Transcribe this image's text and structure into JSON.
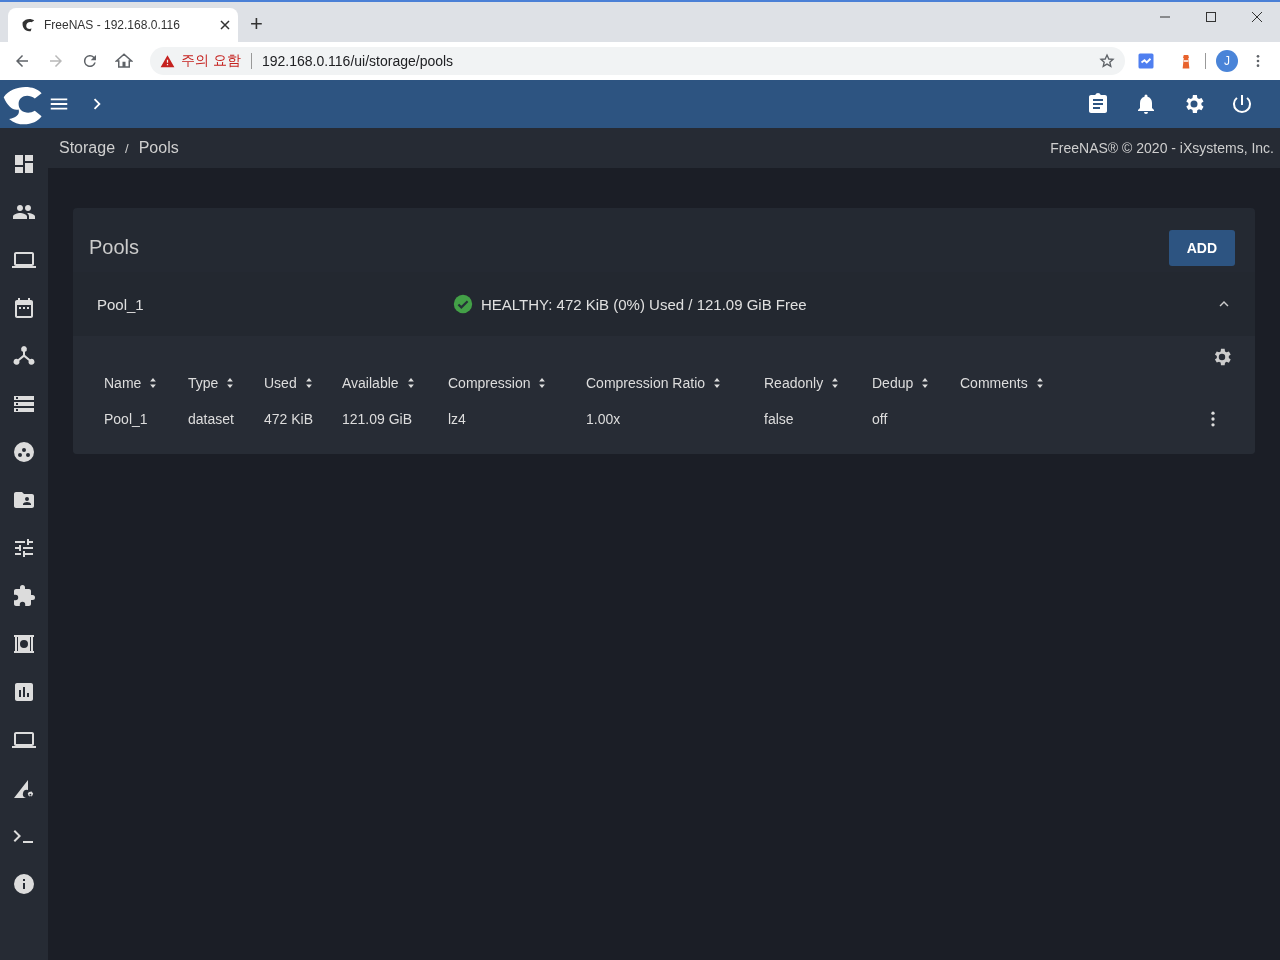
{
  "browser": {
    "tab_title": "FreeNAS - 192.168.0.116",
    "new_tab": "+",
    "forward_disabled": true,
    "security_warning": "주의 요함",
    "url": "192.168.0.116/ui/storage/pools",
    "avatar": "J"
  },
  "breadcrumb": [
    "Storage",
    "Pools"
  ],
  "breadcrumb_separator": "/",
  "copyright": "FreeNAS® © 2020 - iXsystems, Inc.",
  "card": {
    "title": "Pools",
    "add_button": "ADD"
  },
  "pool": {
    "name": "Pool_1",
    "healthy": true,
    "status": "HEALTHY: 472 KiB (0%) Used / 121.09 GiB Free",
    "expanded": true,
    "table": {
      "columns": [
        "Name",
        "Type",
        "Used",
        "Available",
        "Compression",
        "Compression Ratio",
        "Readonly",
        "Dedup",
        "Comments"
      ],
      "rows": [
        [
          "Pool_1",
          "dataset",
          "472 KiB",
          "121.09 GiB",
          "lz4",
          "1.00x",
          "false",
          "off",
          null
        ]
      ]
    }
  }
}
